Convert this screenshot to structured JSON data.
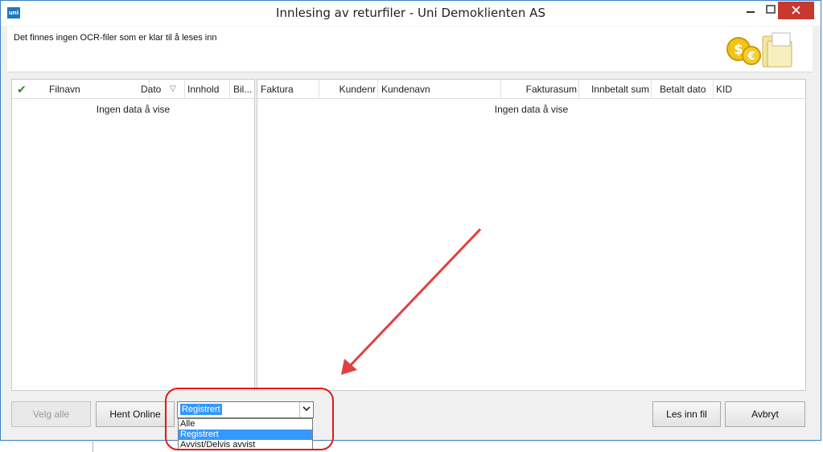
{
  "window": {
    "title": "Innlesing av returfiler - Uni Demoklienten AS",
    "app_icon_text": "uni",
    "min_glyph": "—",
    "max_glyph": "☐",
    "close_glyph": "✕"
  },
  "header": {
    "message": "Det finnes ingen OCR-filer som er klar til å leses inn",
    "logo_icon": "coins-folder-icon"
  },
  "left_grid": {
    "columns": [
      "Filnavn",
      "Dato",
      "Innhold",
      "Bil..."
    ],
    "check_icon": "✔",
    "sort_glyph": "▽",
    "empty_text": "Ingen data å vise"
  },
  "right_grid": {
    "columns": [
      "Faktura",
      "Kundenr",
      "Kundenavn",
      "Fakturasum",
      "Innbetalt sum",
      "Betalt dato",
      "KID"
    ],
    "empty_text": "Ingen data å vise"
  },
  "footer": {
    "select_all": "Velg alle",
    "fetch_online": "Hent Online",
    "filter_selected": "Registrert",
    "filter_options": [
      "Alle",
      "Registrert",
      "Avvist/Delvis avvist"
    ],
    "read_file": "Les inn fil",
    "cancel": "Avbryt"
  },
  "colors": {
    "accent": "#3399ff",
    "highlight_ring": "#e01818",
    "close_button": "#c7392f"
  }
}
